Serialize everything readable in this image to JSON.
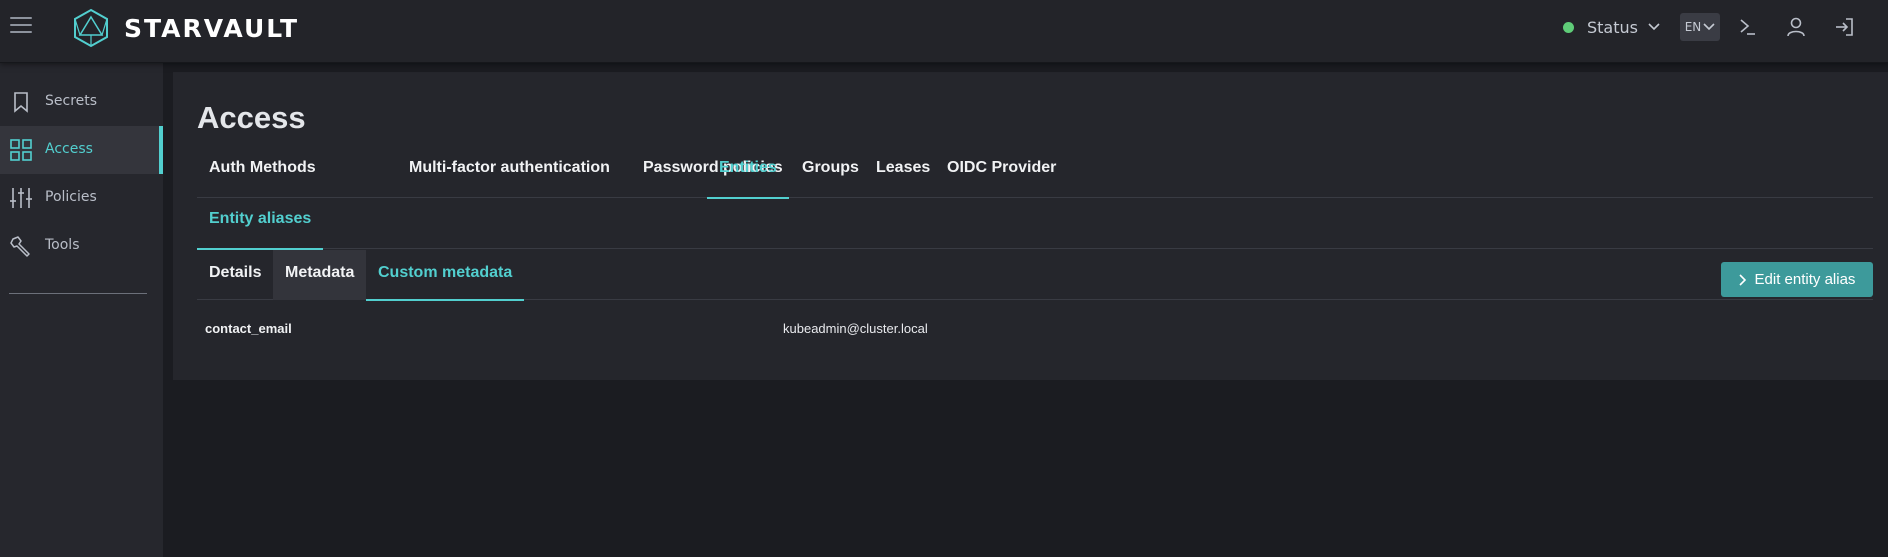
{
  "app": {
    "brand": "STARVAULT"
  },
  "topbar": {
    "status_label": "Status",
    "status_color": "#5fcc78",
    "language": "EN",
    "icons": [
      "terminal-icon",
      "user-icon",
      "logout-icon"
    ]
  },
  "sidebar": {
    "items": [
      {
        "label": "Secrets",
        "icon": "bookmark-icon"
      },
      {
        "label": "Access",
        "icon": "grid-icon"
      },
      {
        "label": "Policies",
        "icon": "sliders-icon"
      },
      {
        "label": "Tools",
        "icon": "wrench-icon"
      }
    ],
    "active": "Access"
  },
  "main": {
    "title": "Access",
    "tabs": [
      {
        "label": "Auth Methods"
      },
      {
        "label": "Multi-factor authentication"
      },
      {
        "label": "Password policies"
      },
      {
        "label": "Entities"
      },
      {
        "label": "Groups"
      },
      {
        "label": "Leases"
      },
      {
        "label": "OIDC Provider"
      }
    ],
    "active_tab": "Entities",
    "subtabs": [
      {
        "label": "Entity aliases"
      }
    ],
    "inner_tabs": [
      {
        "label": "Details"
      },
      {
        "label": "Metadata"
      },
      {
        "label": "Custom metadata"
      }
    ],
    "edit_button_label": "Edit entity alias",
    "metadata": [
      {
        "key": "contact_email",
        "value": "kubeadmin@cluster.local"
      }
    ]
  },
  "colors": {
    "accent": "#52cfcf",
    "button": "#3d9a9b",
    "background": "#1b1c21",
    "panel": "#25262c"
  }
}
